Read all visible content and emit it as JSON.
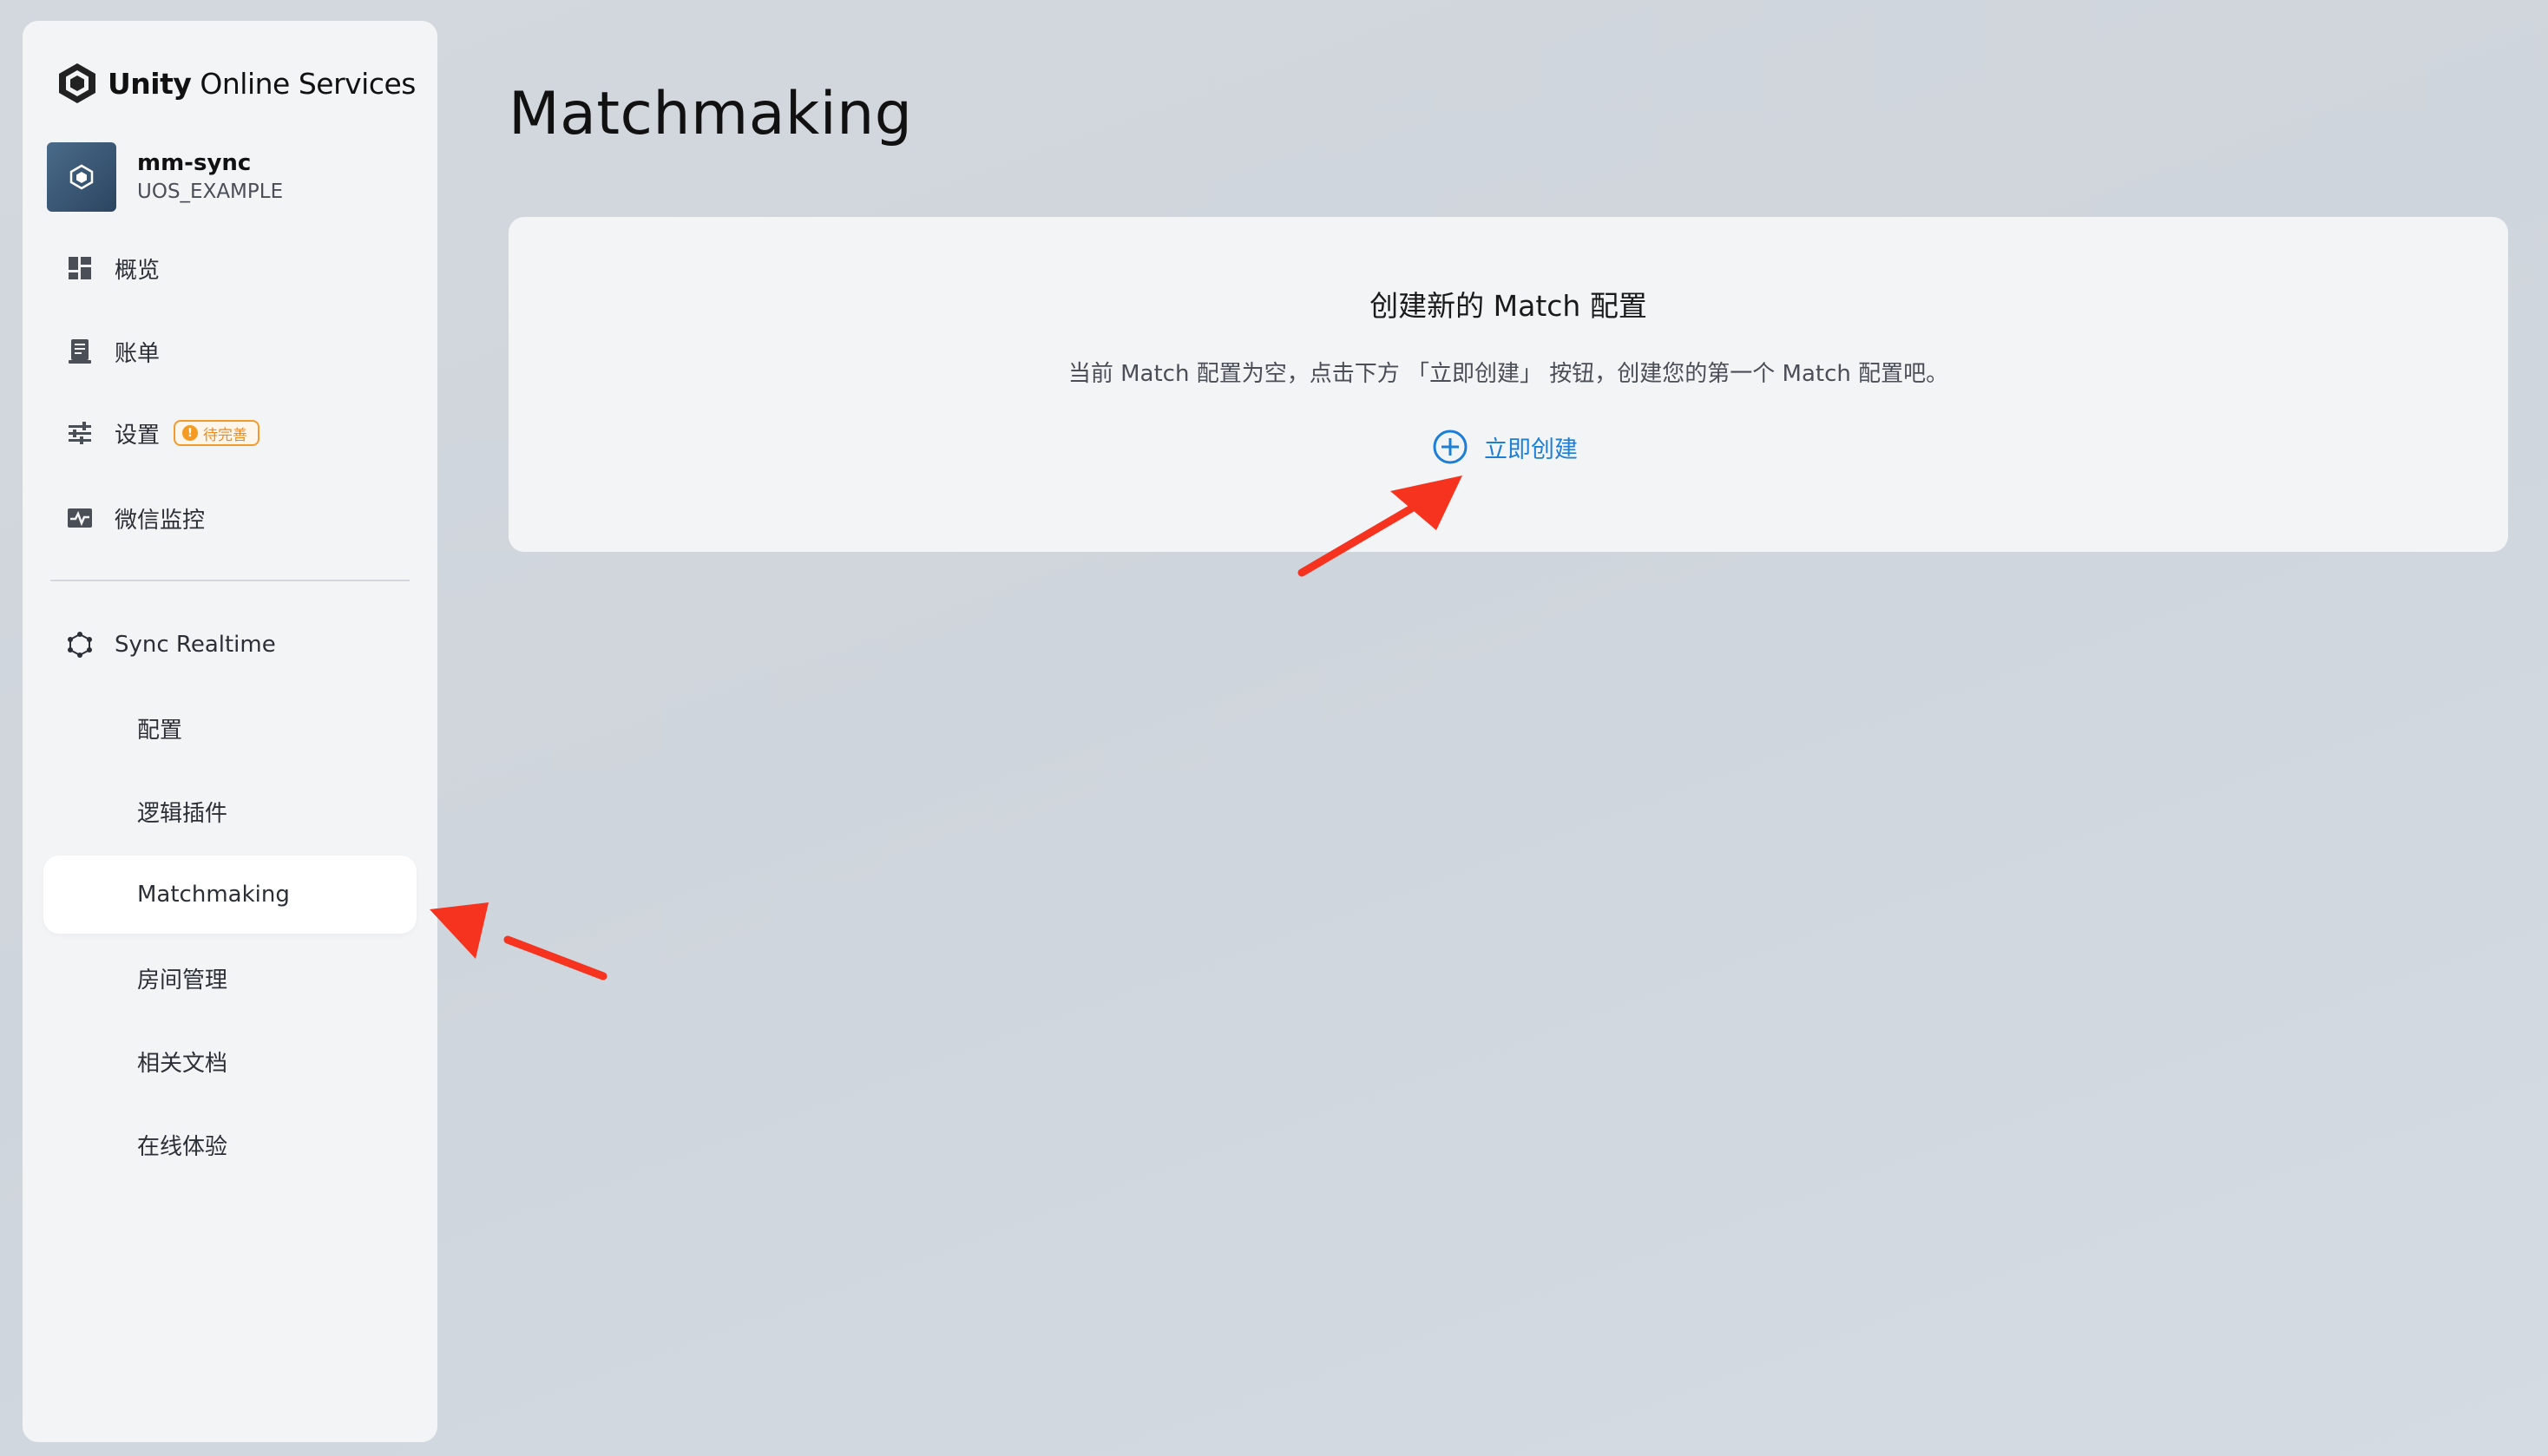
{
  "brand": {
    "name_bold": "Unity",
    "name_rest": " Online Services"
  },
  "project": {
    "name": "mm-sync",
    "sub": "UOS_EXAMPLE"
  },
  "nav": {
    "overview": "概览",
    "billing": "账单",
    "settings": "设置",
    "settings_badge": "待完善",
    "settings_badge_icon": "!",
    "wechat_monitor": "微信监控",
    "sync_realtime": "Sync Realtime",
    "config": "配置",
    "logic_plugin": "逻辑插件",
    "matchmaking": "Matchmaking",
    "room_management": "房间管理",
    "docs": "相关文档",
    "online_trial": "在线体验"
  },
  "main": {
    "title": "Matchmaking",
    "card": {
      "title": "创建新的 Match 配置",
      "description": "当前 Match 配置为空，点击下方 「立即创建」 按钮，创建您的第一个 Match 配置吧。",
      "create_label": "立即创建"
    }
  },
  "colors": {
    "accent": "#1c7ed6",
    "badge": "#f08a16",
    "annotation_arrow": "#f5331f"
  }
}
